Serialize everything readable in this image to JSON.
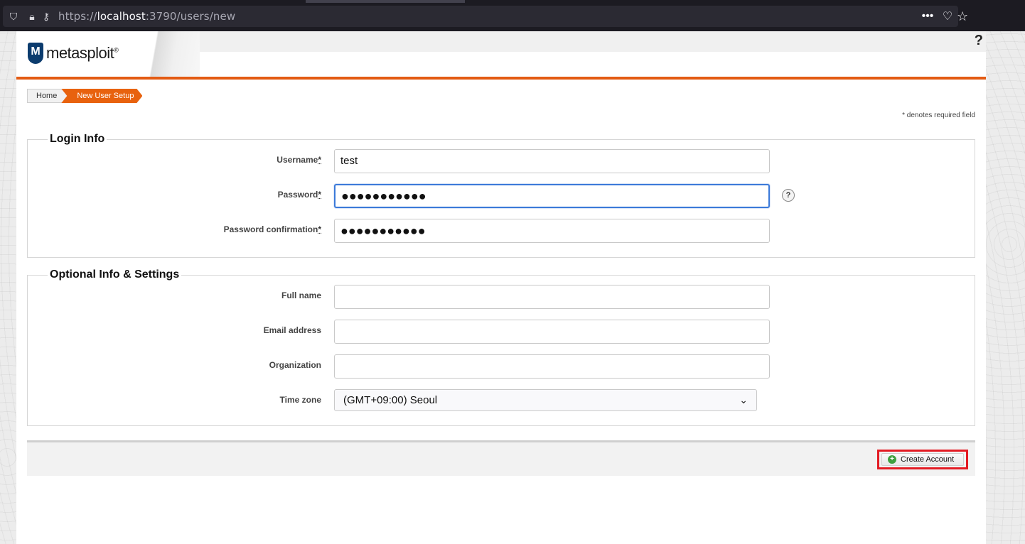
{
  "browser": {
    "url_prefix": "https://",
    "url_host": "localhost",
    "url_rest": ":3790/users/new"
  },
  "header": {
    "logo_text": "metasploit",
    "logo_reg": "®",
    "help": "?"
  },
  "breadcrumb": {
    "home": "Home",
    "current": "New User Setup"
  },
  "required_note": "* denotes required field",
  "login_info": {
    "legend": "Login Info",
    "username_label": "Username",
    "username_value": "test",
    "password_label": "Password",
    "password_value": "●●●●●●●●●●●",
    "password_confirm_label": "Password confirmation",
    "password_confirm_value": "●●●●●●●●●●●",
    "required_mark": "*",
    "help_icon": "?"
  },
  "optional_info": {
    "legend": "Optional Info & Settings",
    "fullname_label": "Full name",
    "email_label": "Email address",
    "organization_label": "Organization",
    "timezone_label": "Time zone",
    "timezone_value": "(GMT+09:00) Seoul"
  },
  "actions": {
    "create_account": "Create Account"
  },
  "colors": {
    "accent_orange": "#e35b13",
    "highlight_red": "#e31b23",
    "focus_blue": "#3b7ad9"
  }
}
